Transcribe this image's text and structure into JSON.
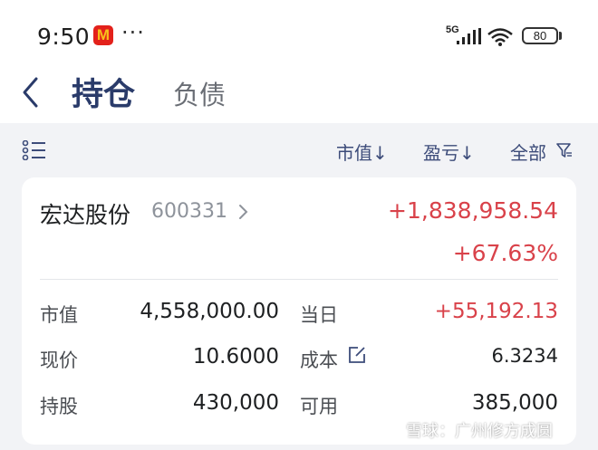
{
  "status_bar": {
    "time": "9:50",
    "app_icon_letter": "M",
    "more": "···",
    "network": "5G",
    "battery": "80",
    "icons": [
      "mcdonalds-app-icon",
      "signal-icon",
      "wifi-icon",
      "battery-icon"
    ]
  },
  "header": {
    "tabs": [
      {
        "label": "持仓",
        "active": true
      },
      {
        "label": "负债",
        "active": false
      }
    ]
  },
  "toolbar": {
    "sort_market_value": "市值↓",
    "sort_profit_loss": "盈亏↓",
    "filter_all": "全部"
  },
  "holding": {
    "name": "宏达股份",
    "code": "600331",
    "profit_loss": "+1,838,958.54",
    "profit_loss_pct": "+67.63%",
    "fields": [
      {
        "label": "市值",
        "value": "4,558,000.00"
      },
      {
        "label": "当日",
        "value": "+55,192.13"
      },
      {
        "label": "现价",
        "value": "10.6000"
      },
      {
        "label": "成本",
        "value": "6.3234"
      },
      {
        "label": "持股",
        "value": "430,000"
      },
      {
        "label": "可用",
        "value": "385,000"
      }
    ]
  },
  "watermark": "雪球：广州修方成圆",
  "colors": {
    "accent": "#2a3b6a",
    "positive": "#d9424a",
    "background": "#f2f3f6"
  }
}
